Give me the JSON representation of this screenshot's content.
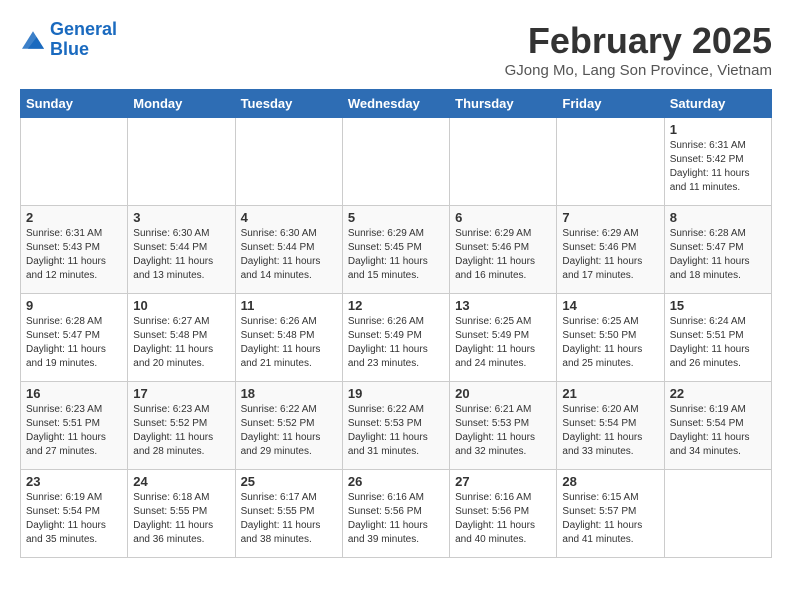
{
  "header": {
    "logo_line1": "General",
    "logo_line2": "Blue",
    "title": "February 2025",
    "subtitle": "GJong Mo, Lang Son Province, Vietnam"
  },
  "days_of_week": [
    "Sunday",
    "Monday",
    "Tuesday",
    "Wednesday",
    "Thursday",
    "Friday",
    "Saturday"
  ],
  "weeks": [
    [
      {
        "day": "",
        "info": ""
      },
      {
        "day": "",
        "info": ""
      },
      {
        "day": "",
        "info": ""
      },
      {
        "day": "",
        "info": ""
      },
      {
        "day": "",
        "info": ""
      },
      {
        "day": "",
        "info": ""
      },
      {
        "day": "1",
        "info": "Sunrise: 6:31 AM\nSunset: 5:42 PM\nDaylight: 11 hours\nand 11 minutes."
      }
    ],
    [
      {
        "day": "2",
        "info": "Sunrise: 6:31 AM\nSunset: 5:43 PM\nDaylight: 11 hours\nand 12 minutes."
      },
      {
        "day": "3",
        "info": "Sunrise: 6:30 AM\nSunset: 5:44 PM\nDaylight: 11 hours\nand 13 minutes."
      },
      {
        "day": "4",
        "info": "Sunrise: 6:30 AM\nSunset: 5:44 PM\nDaylight: 11 hours\nand 14 minutes."
      },
      {
        "day": "5",
        "info": "Sunrise: 6:29 AM\nSunset: 5:45 PM\nDaylight: 11 hours\nand 15 minutes."
      },
      {
        "day": "6",
        "info": "Sunrise: 6:29 AM\nSunset: 5:46 PM\nDaylight: 11 hours\nand 16 minutes."
      },
      {
        "day": "7",
        "info": "Sunrise: 6:29 AM\nSunset: 5:46 PM\nDaylight: 11 hours\nand 17 minutes."
      },
      {
        "day": "8",
        "info": "Sunrise: 6:28 AM\nSunset: 5:47 PM\nDaylight: 11 hours\nand 18 minutes."
      }
    ],
    [
      {
        "day": "9",
        "info": "Sunrise: 6:28 AM\nSunset: 5:47 PM\nDaylight: 11 hours\nand 19 minutes."
      },
      {
        "day": "10",
        "info": "Sunrise: 6:27 AM\nSunset: 5:48 PM\nDaylight: 11 hours\nand 20 minutes."
      },
      {
        "day": "11",
        "info": "Sunrise: 6:26 AM\nSunset: 5:48 PM\nDaylight: 11 hours\nand 21 minutes."
      },
      {
        "day": "12",
        "info": "Sunrise: 6:26 AM\nSunset: 5:49 PM\nDaylight: 11 hours\nand 23 minutes."
      },
      {
        "day": "13",
        "info": "Sunrise: 6:25 AM\nSunset: 5:49 PM\nDaylight: 11 hours\nand 24 minutes."
      },
      {
        "day": "14",
        "info": "Sunrise: 6:25 AM\nSunset: 5:50 PM\nDaylight: 11 hours\nand 25 minutes."
      },
      {
        "day": "15",
        "info": "Sunrise: 6:24 AM\nSunset: 5:51 PM\nDaylight: 11 hours\nand 26 minutes."
      }
    ],
    [
      {
        "day": "16",
        "info": "Sunrise: 6:23 AM\nSunset: 5:51 PM\nDaylight: 11 hours\nand 27 minutes."
      },
      {
        "day": "17",
        "info": "Sunrise: 6:23 AM\nSunset: 5:52 PM\nDaylight: 11 hours\nand 28 minutes."
      },
      {
        "day": "18",
        "info": "Sunrise: 6:22 AM\nSunset: 5:52 PM\nDaylight: 11 hours\nand 29 minutes."
      },
      {
        "day": "19",
        "info": "Sunrise: 6:22 AM\nSunset: 5:53 PM\nDaylight: 11 hours\nand 31 minutes."
      },
      {
        "day": "20",
        "info": "Sunrise: 6:21 AM\nSunset: 5:53 PM\nDaylight: 11 hours\nand 32 minutes."
      },
      {
        "day": "21",
        "info": "Sunrise: 6:20 AM\nSunset: 5:54 PM\nDaylight: 11 hours\nand 33 minutes."
      },
      {
        "day": "22",
        "info": "Sunrise: 6:19 AM\nSunset: 5:54 PM\nDaylight: 11 hours\nand 34 minutes."
      }
    ],
    [
      {
        "day": "23",
        "info": "Sunrise: 6:19 AM\nSunset: 5:54 PM\nDaylight: 11 hours\nand 35 minutes."
      },
      {
        "day": "24",
        "info": "Sunrise: 6:18 AM\nSunset: 5:55 PM\nDaylight: 11 hours\nand 36 minutes."
      },
      {
        "day": "25",
        "info": "Sunrise: 6:17 AM\nSunset: 5:55 PM\nDaylight: 11 hours\nand 38 minutes."
      },
      {
        "day": "26",
        "info": "Sunrise: 6:16 AM\nSunset: 5:56 PM\nDaylight: 11 hours\nand 39 minutes."
      },
      {
        "day": "27",
        "info": "Sunrise: 6:16 AM\nSunset: 5:56 PM\nDaylight: 11 hours\nand 40 minutes."
      },
      {
        "day": "28",
        "info": "Sunrise: 6:15 AM\nSunset: 5:57 PM\nDaylight: 11 hours\nand 41 minutes."
      },
      {
        "day": "",
        "info": ""
      }
    ]
  ]
}
